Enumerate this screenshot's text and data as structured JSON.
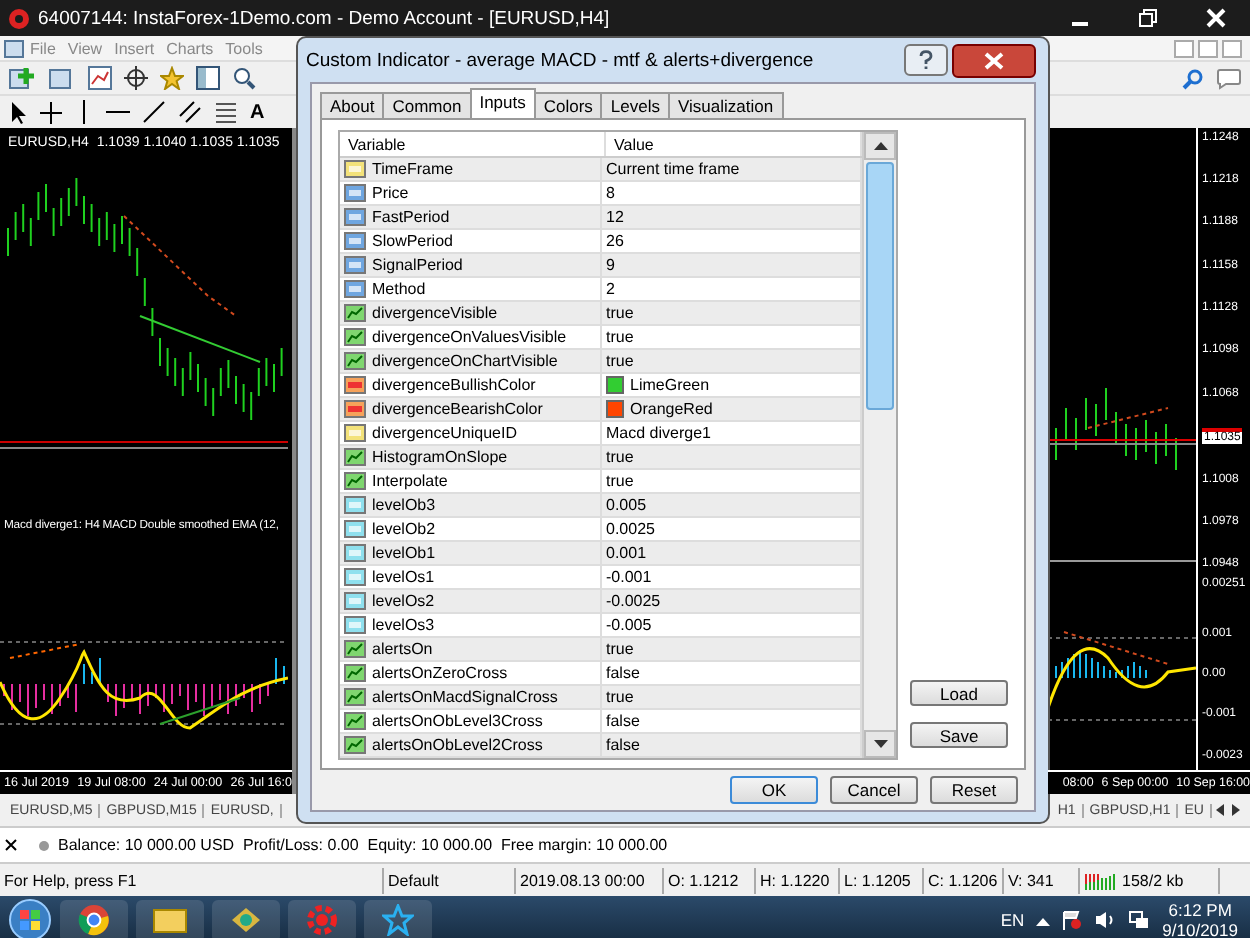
{
  "window": {
    "title": "64007144: InstaForex-1Demo.com - Demo Account - [EURUSD,H4]"
  },
  "menu": [
    "File",
    "View",
    "Insert",
    "Charts",
    "Tools"
  ],
  "toolbar": {
    "text_tool": "A"
  },
  "chart": {
    "header": "EURUSD,H4  1.1039 1.1040 1.1035 1.1035",
    "price_labels": [
      "1.1248",
      "1.1218",
      "1.1188",
      "1.1158",
      "1.1128",
      "1.1098",
      "1.1068",
      "1.1008",
      "1.0978",
      "1.0948"
    ],
    "current_price": "1.1035",
    "indicator_levels": [
      "0.00251",
      "0.001",
      "0.00",
      "-0.001",
      "-0.0023"
    ],
    "indicator_label": "Macd diverge1:  H4 MACD Double smoothed EMA (12,",
    "time_labels_left": [
      "16 Jul 2019",
      "19 Jul 08:00",
      "24 Jul 00:00",
      "26 Jul 16:0"
    ],
    "time_labels_right": [
      "08:00",
      "6 Sep 00:00",
      "10 Sep 16:00"
    ]
  },
  "dialog": {
    "title": "Custom Indicator - average MACD - mtf & alerts+divergence",
    "tabs": [
      {
        "label": "About",
        "selected": false
      },
      {
        "label": "Common",
        "selected": false
      },
      {
        "label": "Inputs",
        "selected": true
      },
      {
        "label": "Colors",
        "selected": false
      },
      {
        "label": "Levels",
        "selected": false
      },
      {
        "label": "Visualization",
        "selected": false
      }
    ],
    "columns": [
      "Variable",
      "Value"
    ],
    "rows": [
      {
        "name": "TimeFrame",
        "value": "Current time frame",
        "kind": "string"
      },
      {
        "name": "Price",
        "value": "8",
        "kind": "int"
      },
      {
        "name": "FastPeriod",
        "value": "12",
        "kind": "int"
      },
      {
        "name": "SlowPeriod",
        "value": "26",
        "kind": "int"
      },
      {
        "name": "SignalPeriod",
        "value": "9",
        "kind": "int"
      },
      {
        "name": "Method",
        "value": "2",
        "kind": "int"
      },
      {
        "name": "divergenceVisible",
        "value": "true",
        "kind": "bool"
      },
      {
        "name": "divergenceOnValuesVisible",
        "value": "true",
        "kind": "bool"
      },
      {
        "name": "divergenceOnChartVisible",
        "value": "true",
        "kind": "bool"
      },
      {
        "name": "divergenceBullishColor",
        "value": "LimeGreen",
        "kind": "color",
        "color": "#32cd32"
      },
      {
        "name": "divergenceBearishColor",
        "value": "OrangeRed",
        "kind": "color",
        "color": "#ff4500"
      },
      {
        "name": "divergenceUniqueID",
        "value": "Macd diverge1",
        "kind": "string"
      },
      {
        "name": "HistogramOnSlope",
        "value": "true",
        "kind": "bool"
      },
      {
        "name": "Interpolate",
        "value": "true",
        "kind": "bool"
      },
      {
        "name": "levelOb3",
        "value": "0.005",
        "kind": "double"
      },
      {
        "name": "levelOb2",
        "value": "0.0025",
        "kind": "double"
      },
      {
        "name": "levelOb1",
        "value": "0.001",
        "kind": "double"
      },
      {
        "name": "levelOs1",
        "value": "-0.001",
        "kind": "double"
      },
      {
        "name": "levelOs2",
        "value": "-0.0025",
        "kind": "double"
      },
      {
        "name": "levelOs3",
        "value": "-0.005",
        "kind": "double"
      },
      {
        "name": "alertsOn",
        "value": "true",
        "kind": "bool"
      },
      {
        "name": "alertsOnZeroCross",
        "value": "false",
        "kind": "bool"
      },
      {
        "name": "alertsOnMacdSignalCross",
        "value": "true",
        "kind": "bool"
      },
      {
        "name": "alertsOnObLevel3Cross",
        "value": "false",
        "kind": "bool"
      },
      {
        "name": "alertsOnObLevel2Cross",
        "value": "false",
        "kind": "bool"
      }
    ],
    "side_buttons": [
      "Load",
      "Save"
    ],
    "buttons": [
      "OK",
      "Cancel",
      "Reset"
    ]
  },
  "chart_tabs_left": [
    "EURUSD,M5",
    "GBPUSD,M15",
    "EURUSD,"
  ],
  "chart_tabs_right": [
    "H1",
    "GBPUSD,H1",
    "EU"
  ],
  "terminal": {
    "summary": "Balance: 10 000.00 USD  Profit/Loss: 0.00  Equity: 10 000.00  Free margin: 10 000.00"
  },
  "status_bar": [
    "For Help, press F1",
    "Default",
    "2019.08.13 00:00",
    "O: 1.1212",
    "H: 1.1220",
    "L: 1.1205",
    "C: 1.1206",
    "V: 341",
    "158/2 kb"
  ],
  "taskbar": {
    "language": "EN",
    "time": "6:12 PM",
    "date": "9/10/2019"
  }
}
